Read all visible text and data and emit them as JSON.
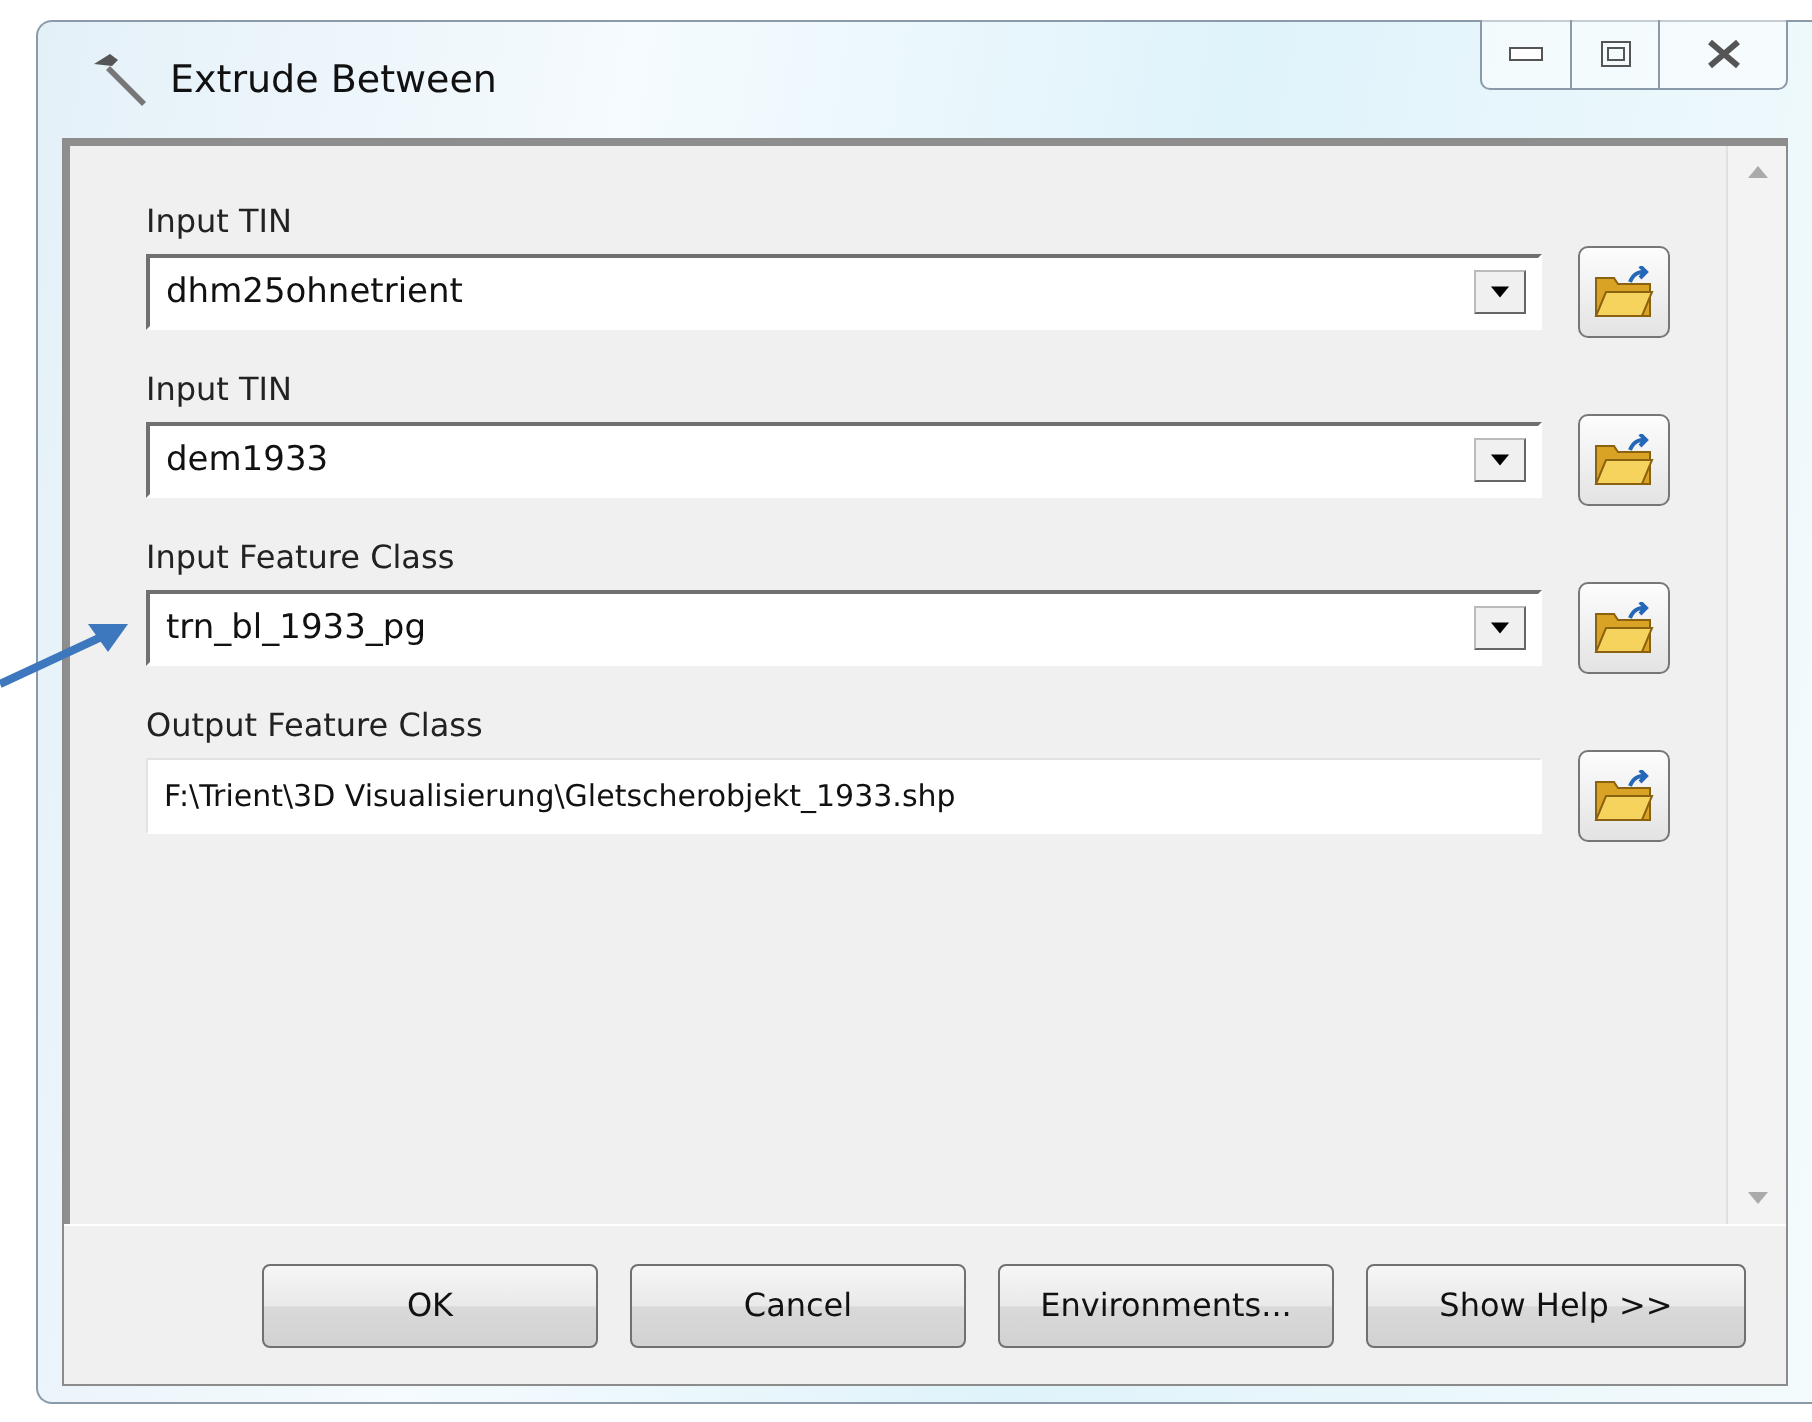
{
  "window": {
    "title": "Extrude Between"
  },
  "parameters": [
    {
      "label": "Input TIN",
      "value": "dhm25ohnetrient",
      "kind": "dropdown"
    },
    {
      "label": "Input TIN",
      "value": "dem1933",
      "kind": "dropdown"
    },
    {
      "label": "Input Feature Class",
      "value": "trn_bl_1933_pg",
      "kind": "dropdown"
    },
    {
      "label": "Output Feature Class",
      "value": "F:\\Trient\\3D Visualisierung\\Gletscherobjekt_1933.shp",
      "kind": "text"
    }
  ],
  "buttons": [
    "OK",
    "Cancel",
    "Environments...",
    "Show Help >>"
  ]
}
